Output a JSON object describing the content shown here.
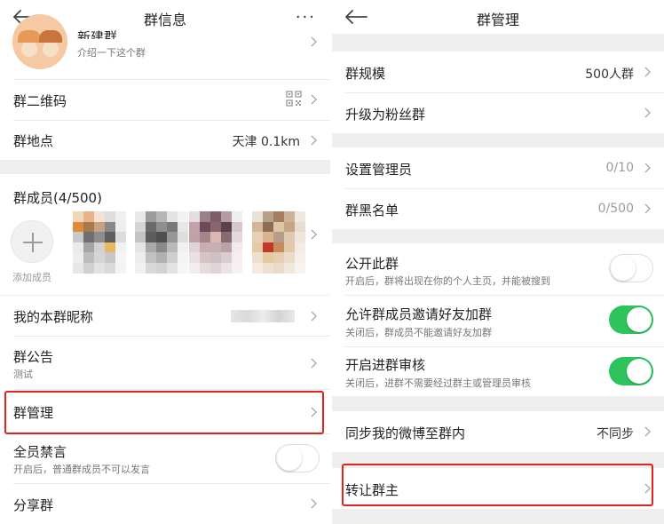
{
  "left": {
    "header": {
      "title": "群信息",
      "more": "···"
    },
    "group_card": {
      "name": "新建群",
      "intro": "介绍一下这个群"
    },
    "qrcode_label": "群二维码",
    "location": {
      "label": "群地点",
      "value": "天津 0.1km"
    },
    "members": {
      "label": "群成员(4/500)",
      "add_label": "添加成员"
    },
    "nickname_label": "我的本群昵称",
    "notice": {
      "label": "群公告",
      "sub": "测试"
    },
    "manage_label": "群管理",
    "mute": {
      "label": "全员禁言",
      "sub": "开启后，普通群成员不可以发言",
      "state": "off"
    },
    "share_label": "分享群"
  },
  "right": {
    "header": {
      "title": "群管理"
    },
    "scale": {
      "label": "群规模",
      "value": "500人群"
    },
    "upgrade_label": "升级为粉丝群",
    "admins": {
      "label": "设置管理员",
      "value": "0/10"
    },
    "blacklist": {
      "label": "群黑名单",
      "value": "0/500"
    },
    "public": {
      "label": "公开此群",
      "sub": "开启后，群将出现在你的个人主页，并能被搜到",
      "state": "off"
    },
    "invite": {
      "label": "允许群成员邀请好友加群",
      "sub": "关闭后，群成员不能邀请好友加群",
      "state": "on"
    },
    "review": {
      "label": "开启进群审核",
      "sub": "关闭后，进群不需要经过群主或管理员审核",
      "state": "on"
    },
    "weibo_sync": {
      "label": "同步我的微博至群内",
      "value": "不同步"
    },
    "transfer_label": "转让群主"
  },
  "colors": {
    "highlight": "#e2231a",
    "toggle_on": "#2dc35d",
    "background": "#efefef"
  },
  "icons": [
    "back-arrow-icon",
    "more-icon",
    "qrcode-icon",
    "chevron-right-icon",
    "add-icon"
  ]
}
